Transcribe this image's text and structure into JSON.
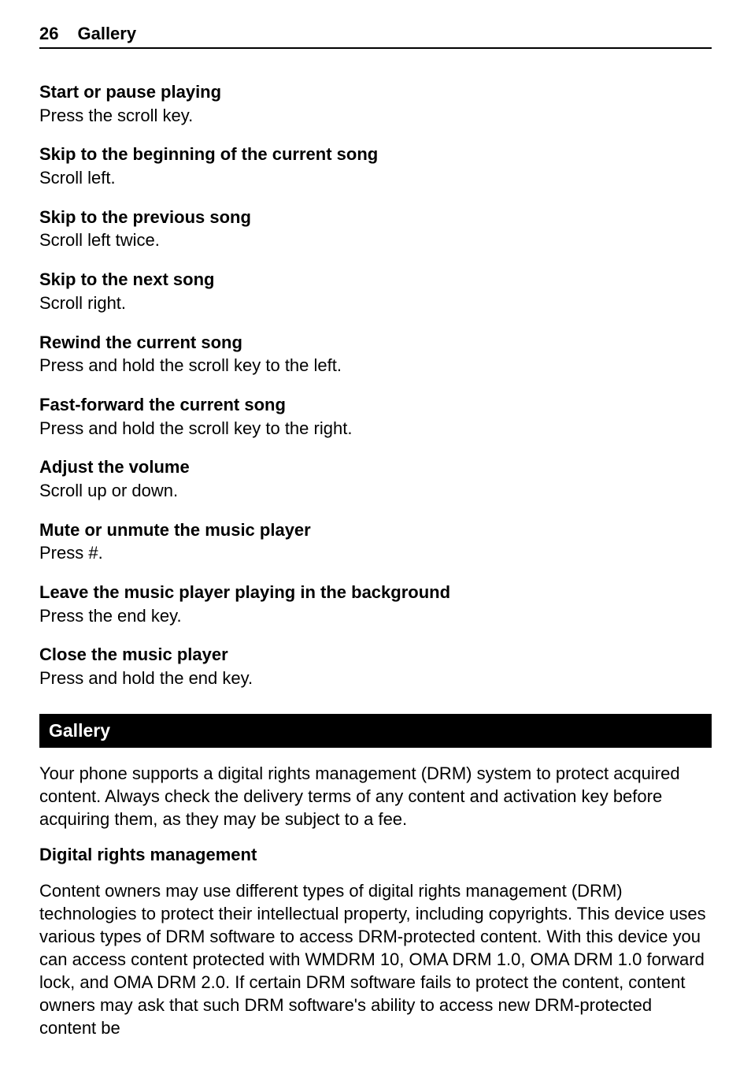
{
  "header": {
    "page_number": "26",
    "title": "Gallery"
  },
  "instructions": [
    {
      "title": "Start or pause playing",
      "body": "Press the scroll key."
    },
    {
      "title": "Skip to the beginning of the current song",
      "body": "Scroll left."
    },
    {
      "title": "Skip to the previous song",
      "body": "Scroll left twice."
    },
    {
      "title": "Skip to the next song",
      "body": "Scroll right."
    },
    {
      "title": "Rewind the current song",
      "body": "Press and hold the scroll key to the left."
    },
    {
      "title": "Fast-forward the current song",
      "body": "Press and hold the scroll key to the right."
    },
    {
      "title": "Adjust the volume",
      "body": "Scroll up or down."
    },
    {
      "title": "Mute or unmute the music player",
      "body": "Press #."
    },
    {
      "title": "Leave the music player playing in the background",
      "body": "Press the end key."
    },
    {
      "title": "Close the music player",
      "body": "Press and hold the end key."
    }
  ],
  "section": {
    "bar_title": "Gallery",
    "intro": "Your phone supports a digital rights management (DRM) system to protect acquired content. Always check the delivery terms of any content and activation key before acquiring them, as they may be subject to a fee.",
    "sub_heading": "Digital rights management",
    "body": "Content owners may use different types of digital rights management (DRM) technologies to protect their intellectual property, including copyrights. This device uses various types of DRM software to access DRM-protected content. With this device you can access content protected with WMDRM 10, OMA DRM 1.0, OMA DRM 1.0 forward lock, and OMA DRM 2.0. If certain DRM software fails to protect the content, content owners may ask that such DRM software's ability to access new DRM-protected content be"
  }
}
